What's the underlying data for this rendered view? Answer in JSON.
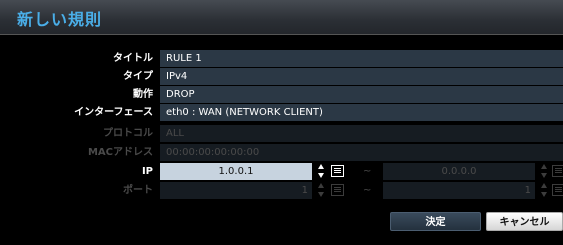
{
  "window": {
    "title": "新しい規則"
  },
  "form": {
    "title": {
      "label": "タイトル",
      "value": "RULE 1"
    },
    "type": {
      "label": "タイプ",
      "value": "IPv4"
    },
    "action": {
      "label": "動作",
      "value": "DROP"
    },
    "interface": {
      "label": "インターフェース",
      "value": "eth0 : WAN (NETWORK CLIENT)"
    },
    "protocol": {
      "label": "プロトコル",
      "value": "ALL",
      "enabled": false
    },
    "mac": {
      "label": "MACアドレス",
      "value": "00:00:00:00:00:00",
      "enabled": false
    },
    "ip": {
      "label": "IP",
      "start": "1.0.0.1",
      "separator": "~",
      "end": "0.0.0.0"
    },
    "port": {
      "label": "ポート",
      "start": "1",
      "separator": "~",
      "end": "1",
      "enabled": false
    }
  },
  "buttons": {
    "ok": "決定",
    "cancel": "キャンセル"
  },
  "colors": {
    "title": "#4aaee8",
    "field_bg": "#2b3845",
    "field_disabled_bg": "#161c22",
    "ip_active_bg": "#c7d3df",
    "disabled_text": "#4a4a4a"
  }
}
